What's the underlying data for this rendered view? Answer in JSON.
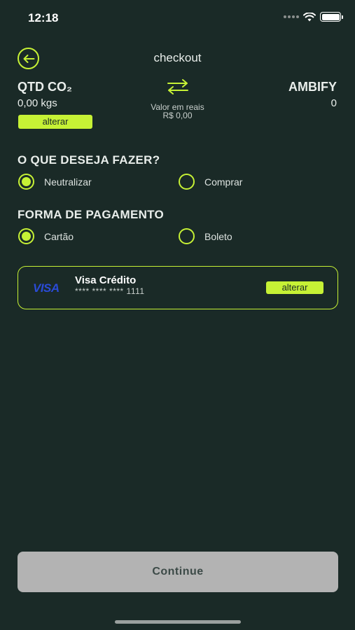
{
  "status_bar": {
    "time": "12:18"
  },
  "header": {
    "title": "checkout",
    "back_icon": "arrow-left-icon"
  },
  "summary": {
    "qtd_label": "QTD CO₂",
    "qtd_value": "0,00 kgs",
    "alterar_label": "alterar",
    "valor_label": "Valor em reais",
    "valor_value": "R$ 0,00",
    "ambify_label": "AMBIFY",
    "ambify_value": "0",
    "swap_icon": "swap-arrows-icon"
  },
  "action_section": {
    "title": "O QUE DESEJA FAZER?",
    "options": [
      {
        "label": "Neutralizar",
        "selected": true
      },
      {
        "label": "Comprar",
        "selected": false
      }
    ]
  },
  "payment_section": {
    "title": "FORMA DE PAGAMENTO",
    "options": [
      {
        "label": "Cartão",
        "selected": true
      },
      {
        "label": "Boleto",
        "selected": false
      }
    ]
  },
  "card": {
    "brand": "VISA",
    "name": "Visa Crédito",
    "number": "**** **** **** 1111",
    "alterar_label": "alterar"
  },
  "continue_label": "Continue",
  "colors": {
    "accent": "#c6f135",
    "background": "#1a2a27",
    "button_disabled": "#b3b3b3",
    "visa_blue": "#2a4bd6"
  }
}
